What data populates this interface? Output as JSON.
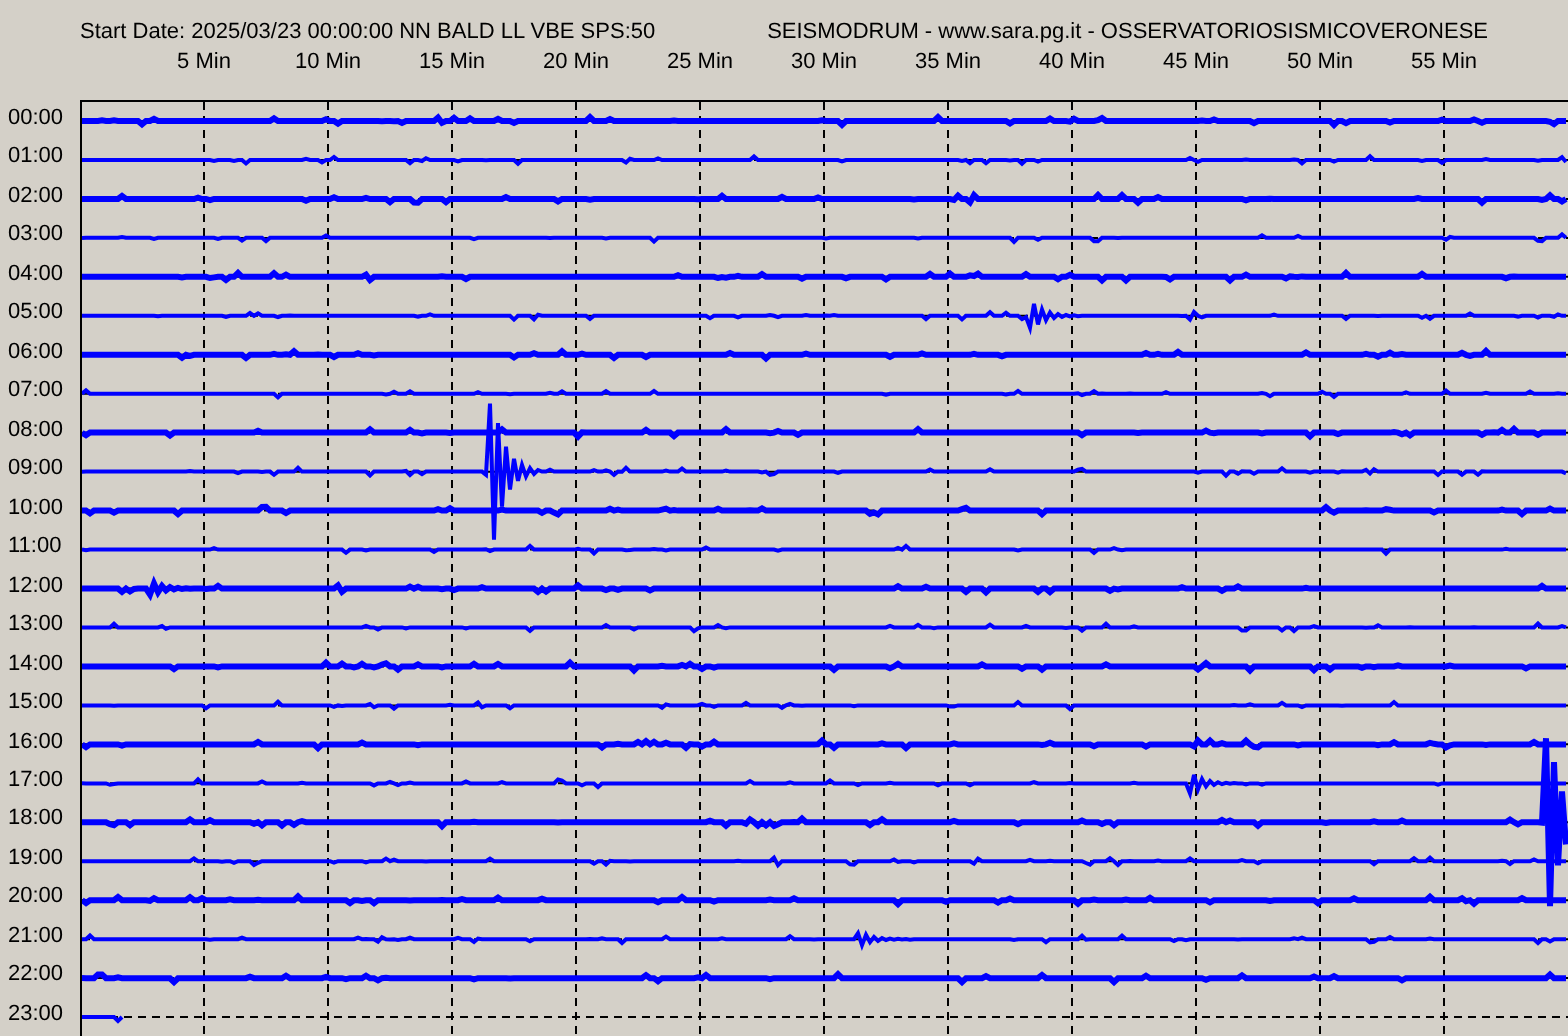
{
  "header": {
    "start_info": "Start Date: 2025/03/23 00:00:00 NN BALD LL VBE SPS:50",
    "source": "SEISMODRUM - www.sara.pg.it - OSSERVATORIOSISMICOVERONESE"
  },
  "minute_labels": [
    "5 Min",
    "10 Min",
    "15 Min",
    "20 Min",
    "25 Min",
    "30 Min",
    "35 Min",
    "40 Min",
    "45 Min",
    "50 Min",
    "55 Min"
  ],
  "hour_labels": [
    "00:00",
    "01:00",
    "02:00",
    "03:00",
    "04:00",
    "05:00",
    "06:00",
    "07:00",
    "08:00",
    "09:00",
    "10:00",
    "11:00",
    "12:00",
    "13:00",
    "14:00",
    "15:00",
    "16:00",
    "17:00",
    "18:00",
    "19:00",
    "20:00",
    "21:00",
    "22:00",
    "23:00"
  ]
}
